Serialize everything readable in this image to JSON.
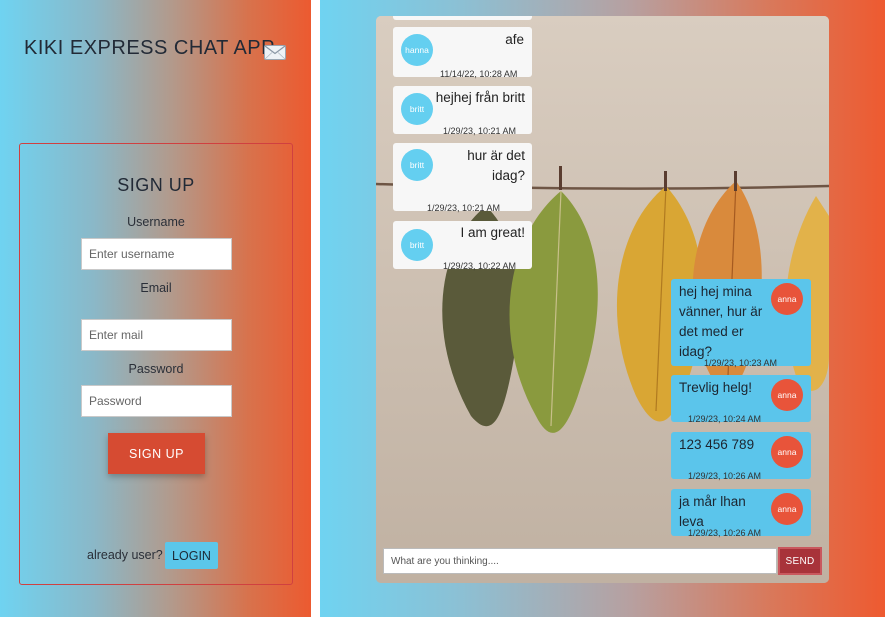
{
  "app": {
    "title": "KIKI EXPRESS CHAT APP"
  },
  "signup": {
    "title": "SIGN UP",
    "username_label": "Username",
    "username_placeholder": "Enter username",
    "email_label": "Email",
    "email_placeholder": "Enter mail",
    "password_label": "Password",
    "password_placeholder": "Password",
    "button_label": "SIGN UP",
    "already_text": "already user?",
    "login_label": "LOGIN"
  },
  "chat": {
    "messages": [
      {
        "user": "hanna",
        "text": "afe",
        "time": "11/14/22, 10:28 AM",
        "mine": false
      },
      {
        "user": "britt",
        "text": "hejhej från britt",
        "time": "1/29/23, 10:21 AM",
        "mine": false
      },
      {
        "user": "britt",
        "text": "hur är det idag?",
        "time": "1/29/23, 10:21 AM",
        "mine": false
      },
      {
        "user": "britt",
        "text": "I am great!",
        "time": "1/29/23, 10:22 AM",
        "mine": false
      },
      {
        "user": "anna",
        "text": "hej hej mina vänner, hur är det med er idag?",
        "time": "1/29/23, 10:23 AM",
        "mine": true
      },
      {
        "user": "anna",
        "text": "Trevlig helg!",
        "time": "1/29/23, 10:24 AM",
        "mine": true
      },
      {
        "user": "anna",
        "text": "123 456 789",
        "time": "1/29/23, 10:26 AM",
        "mine": true
      },
      {
        "user": "anna",
        "text": "ja mår lhan leva",
        "time": "1/29/23, 10:26 AM",
        "mine": true
      }
    ],
    "input_placeholder": "What are you thinking....",
    "send_label": "SEND"
  },
  "icons": {
    "title_icon": "envelope-icon"
  },
  "colors": {
    "signup_button": "#d64b32",
    "login_button": "#5bc7ea",
    "send_button": "#a8333a",
    "own_message": "#5bc5eb",
    "avatar_other": "#64cff0",
    "avatar_own": "#e8543a"
  }
}
